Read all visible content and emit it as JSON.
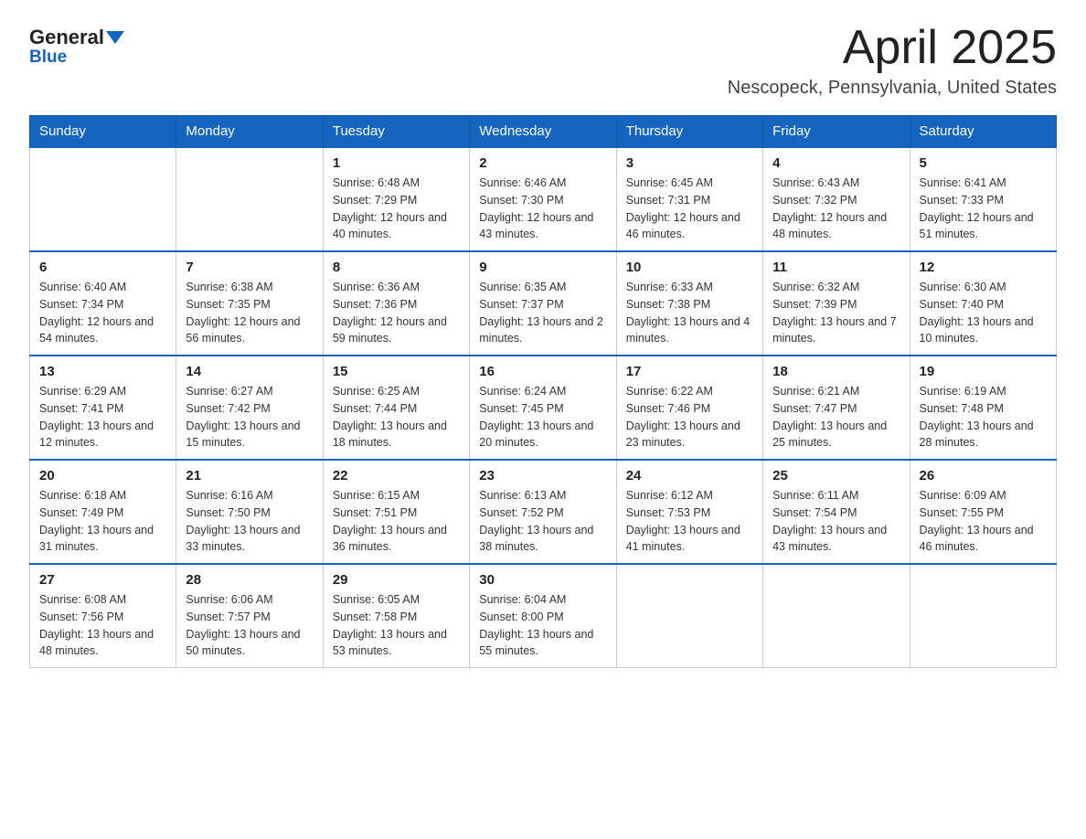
{
  "logo": {
    "text_general": "General",
    "text_blue": "Blue"
  },
  "header": {
    "month_year": "April 2025",
    "location": "Nescopeck, Pennsylvania, United States"
  },
  "weekdays": [
    "Sunday",
    "Monday",
    "Tuesday",
    "Wednesday",
    "Thursday",
    "Friday",
    "Saturday"
  ],
  "weeks": [
    [
      {
        "day": "",
        "sunrise": "",
        "sunset": "",
        "daylight": ""
      },
      {
        "day": "",
        "sunrise": "",
        "sunset": "",
        "daylight": ""
      },
      {
        "day": "1",
        "sunrise": "Sunrise: 6:48 AM",
        "sunset": "Sunset: 7:29 PM",
        "daylight": "Daylight: 12 hours and 40 minutes."
      },
      {
        "day": "2",
        "sunrise": "Sunrise: 6:46 AM",
        "sunset": "Sunset: 7:30 PM",
        "daylight": "Daylight: 12 hours and 43 minutes."
      },
      {
        "day": "3",
        "sunrise": "Sunrise: 6:45 AM",
        "sunset": "Sunset: 7:31 PM",
        "daylight": "Daylight: 12 hours and 46 minutes."
      },
      {
        "day": "4",
        "sunrise": "Sunrise: 6:43 AM",
        "sunset": "Sunset: 7:32 PM",
        "daylight": "Daylight: 12 hours and 48 minutes."
      },
      {
        "day": "5",
        "sunrise": "Sunrise: 6:41 AM",
        "sunset": "Sunset: 7:33 PM",
        "daylight": "Daylight: 12 hours and 51 minutes."
      }
    ],
    [
      {
        "day": "6",
        "sunrise": "Sunrise: 6:40 AM",
        "sunset": "Sunset: 7:34 PM",
        "daylight": "Daylight: 12 hours and 54 minutes."
      },
      {
        "day": "7",
        "sunrise": "Sunrise: 6:38 AM",
        "sunset": "Sunset: 7:35 PM",
        "daylight": "Daylight: 12 hours and 56 minutes."
      },
      {
        "day": "8",
        "sunrise": "Sunrise: 6:36 AM",
        "sunset": "Sunset: 7:36 PM",
        "daylight": "Daylight: 12 hours and 59 minutes."
      },
      {
        "day": "9",
        "sunrise": "Sunrise: 6:35 AM",
        "sunset": "Sunset: 7:37 PM",
        "daylight": "Daylight: 13 hours and 2 minutes."
      },
      {
        "day": "10",
        "sunrise": "Sunrise: 6:33 AM",
        "sunset": "Sunset: 7:38 PM",
        "daylight": "Daylight: 13 hours and 4 minutes."
      },
      {
        "day": "11",
        "sunrise": "Sunrise: 6:32 AM",
        "sunset": "Sunset: 7:39 PM",
        "daylight": "Daylight: 13 hours and 7 minutes."
      },
      {
        "day": "12",
        "sunrise": "Sunrise: 6:30 AM",
        "sunset": "Sunset: 7:40 PM",
        "daylight": "Daylight: 13 hours and 10 minutes."
      }
    ],
    [
      {
        "day": "13",
        "sunrise": "Sunrise: 6:29 AM",
        "sunset": "Sunset: 7:41 PM",
        "daylight": "Daylight: 13 hours and 12 minutes."
      },
      {
        "day": "14",
        "sunrise": "Sunrise: 6:27 AM",
        "sunset": "Sunset: 7:42 PM",
        "daylight": "Daylight: 13 hours and 15 minutes."
      },
      {
        "day": "15",
        "sunrise": "Sunrise: 6:25 AM",
        "sunset": "Sunset: 7:44 PM",
        "daylight": "Daylight: 13 hours and 18 minutes."
      },
      {
        "day": "16",
        "sunrise": "Sunrise: 6:24 AM",
        "sunset": "Sunset: 7:45 PM",
        "daylight": "Daylight: 13 hours and 20 minutes."
      },
      {
        "day": "17",
        "sunrise": "Sunrise: 6:22 AM",
        "sunset": "Sunset: 7:46 PM",
        "daylight": "Daylight: 13 hours and 23 minutes."
      },
      {
        "day": "18",
        "sunrise": "Sunrise: 6:21 AM",
        "sunset": "Sunset: 7:47 PM",
        "daylight": "Daylight: 13 hours and 25 minutes."
      },
      {
        "day": "19",
        "sunrise": "Sunrise: 6:19 AM",
        "sunset": "Sunset: 7:48 PM",
        "daylight": "Daylight: 13 hours and 28 minutes."
      }
    ],
    [
      {
        "day": "20",
        "sunrise": "Sunrise: 6:18 AM",
        "sunset": "Sunset: 7:49 PM",
        "daylight": "Daylight: 13 hours and 31 minutes."
      },
      {
        "day": "21",
        "sunrise": "Sunrise: 6:16 AM",
        "sunset": "Sunset: 7:50 PM",
        "daylight": "Daylight: 13 hours and 33 minutes."
      },
      {
        "day": "22",
        "sunrise": "Sunrise: 6:15 AM",
        "sunset": "Sunset: 7:51 PM",
        "daylight": "Daylight: 13 hours and 36 minutes."
      },
      {
        "day": "23",
        "sunrise": "Sunrise: 6:13 AM",
        "sunset": "Sunset: 7:52 PM",
        "daylight": "Daylight: 13 hours and 38 minutes."
      },
      {
        "day": "24",
        "sunrise": "Sunrise: 6:12 AM",
        "sunset": "Sunset: 7:53 PM",
        "daylight": "Daylight: 13 hours and 41 minutes."
      },
      {
        "day": "25",
        "sunrise": "Sunrise: 6:11 AM",
        "sunset": "Sunset: 7:54 PM",
        "daylight": "Daylight: 13 hours and 43 minutes."
      },
      {
        "day": "26",
        "sunrise": "Sunrise: 6:09 AM",
        "sunset": "Sunset: 7:55 PM",
        "daylight": "Daylight: 13 hours and 46 minutes."
      }
    ],
    [
      {
        "day": "27",
        "sunrise": "Sunrise: 6:08 AM",
        "sunset": "Sunset: 7:56 PM",
        "daylight": "Daylight: 13 hours and 48 minutes."
      },
      {
        "day": "28",
        "sunrise": "Sunrise: 6:06 AM",
        "sunset": "Sunset: 7:57 PM",
        "daylight": "Daylight: 13 hours and 50 minutes."
      },
      {
        "day": "29",
        "sunrise": "Sunrise: 6:05 AM",
        "sunset": "Sunset: 7:58 PM",
        "daylight": "Daylight: 13 hours and 53 minutes."
      },
      {
        "day": "30",
        "sunrise": "Sunrise: 6:04 AM",
        "sunset": "Sunset: 8:00 PM",
        "daylight": "Daylight: 13 hours and 55 minutes."
      },
      {
        "day": "",
        "sunrise": "",
        "sunset": "",
        "daylight": ""
      },
      {
        "day": "",
        "sunrise": "",
        "sunset": "",
        "daylight": ""
      },
      {
        "day": "",
        "sunrise": "",
        "sunset": "",
        "daylight": ""
      }
    ]
  ]
}
